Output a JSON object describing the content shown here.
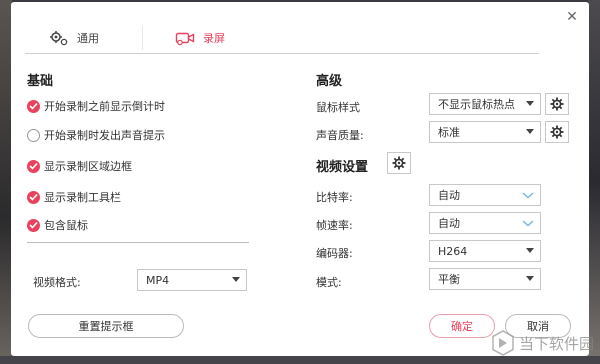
{
  "tabs": [
    {
      "label": "通用",
      "icon": "gears-icon",
      "active": false
    },
    {
      "label": "录屏",
      "icon": "video-camera-icon",
      "active": true
    }
  ],
  "basic": {
    "title": "基础",
    "options": [
      {
        "label": "开始录制之前显示倒计时",
        "checked": true
      },
      {
        "label": "开始录制时发出声音提示",
        "checked": false
      },
      {
        "label": "显示录制区域边框",
        "checked": true
      },
      {
        "label": "显示录制工具栏",
        "checked": true
      },
      {
        "label": "包含鼠标",
        "checked": true
      }
    ],
    "video_format_label": "视频格式:",
    "video_format_value": "MP4"
  },
  "advanced": {
    "title": "高级",
    "cursor_style_label": "鼠标样式",
    "cursor_style_value": "不显示鼠标热点",
    "audio_quality_label": "声音质量:",
    "audio_quality_value": "标准"
  },
  "video_settings": {
    "title": "视频设置",
    "bitrate_label": "比特率:",
    "bitrate_value": "自动",
    "framerate_label": "帧速率:",
    "framerate_value": "自动",
    "encoder_label": "编码器:",
    "encoder_value": "H264",
    "mode_label": "模式:",
    "mode_value": "平衡"
  },
  "buttons": {
    "reset_label": "重置提示框",
    "ok_label": "确定",
    "cancel_label": "取消"
  },
  "watermark": {
    "text": "当下软件园"
  },
  "colors": {
    "accent": "#e9425e",
    "chevron": "#7fb3e0"
  }
}
